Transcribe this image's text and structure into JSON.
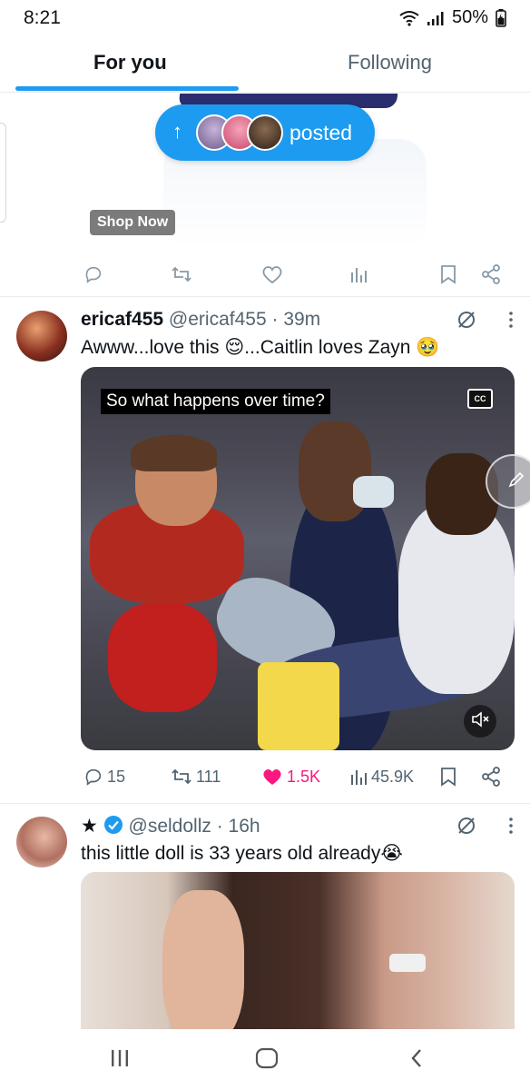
{
  "status_bar": {
    "time": "8:21",
    "battery": "50%",
    "icons": [
      "wifi-icon",
      "signal-icon",
      "battery-icon"
    ]
  },
  "tabs": [
    {
      "label": "For you",
      "selected": true
    },
    {
      "label": "Following",
      "selected": false
    }
  ],
  "accent_color": "#1d9bf0",
  "ad": {
    "shop_label": "Shop Now"
  },
  "posted_pill": {
    "label": "posted",
    "icon": "arrow-up-icon"
  },
  "tweets": [
    {
      "display_name": "ericaf455",
      "handle": "@ericaf455",
      "time": "39m",
      "text": "Awww...love this 😌...Caitlin loves Zayn 🥹",
      "media": {
        "type": "video",
        "caption": "So what happens over time?",
        "cc_label": "CC"
      },
      "stats": {
        "replies": "15",
        "reposts": "111",
        "likes": "1.5K",
        "views": "45.9K"
      },
      "liked": true
    },
    {
      "display_name_prefix": "★",
      "verified": true,
      "handle": "@seldollz",
      "time": "16h",
      "text": "this little doll is 33 years old already😭",
      "media": {
        "type": "image"
      }
    }
  ],
  "nav_bar": {
    "icons": [
      "recent-apps-icon",
      "home-icon",
      "back-icon"
    ]
  }
}
